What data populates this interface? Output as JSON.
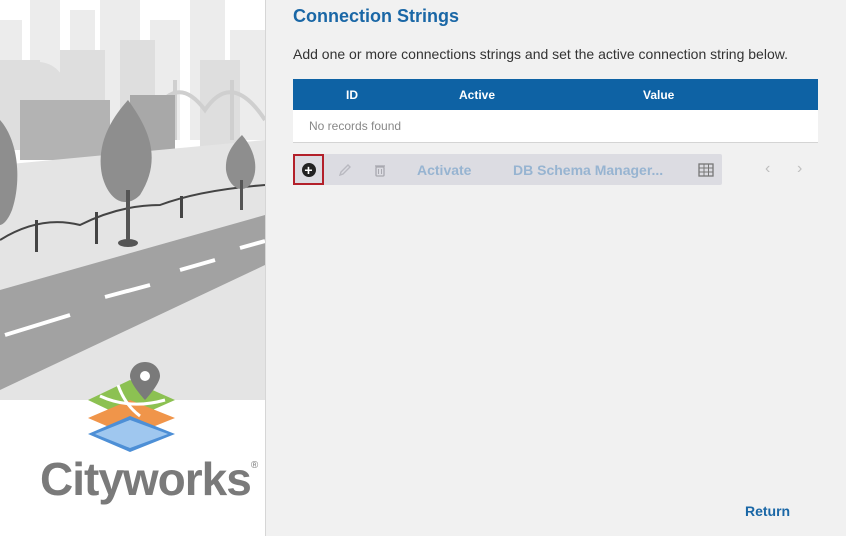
{
  "brand": {
    "name": "Cityworks",
    "registered": "®"
  },
  "page": {
    "title": "Connection Strings",
    "description": "Add one or more connections strings and set the active connection string below."
  },
  "grid": {
    "columns": [
      "ID",
      "Active",
      "Value"
    ],
    "empty_text": "No records found"
  },
  "toolbar": {
    "add_icon": "plus-circle-icon",
    "edit_icon": "pencil-icon",
    "delete_icon": "trash-icon",
    "activate_label": "Activate",
    "schema_label": "DB Schema Manager...",
    "columns_icon": "table-columns-icon"
  },
  "pager": {
    "prev": "‹",
    "next": "›"
  },
  "footer": {
    "return_label": "Return"
  },
  "colors": {
    "accent": "#0e62a4",
    "title": "#1a67a6",
    "highlight": "#b3202a"
  }
}
